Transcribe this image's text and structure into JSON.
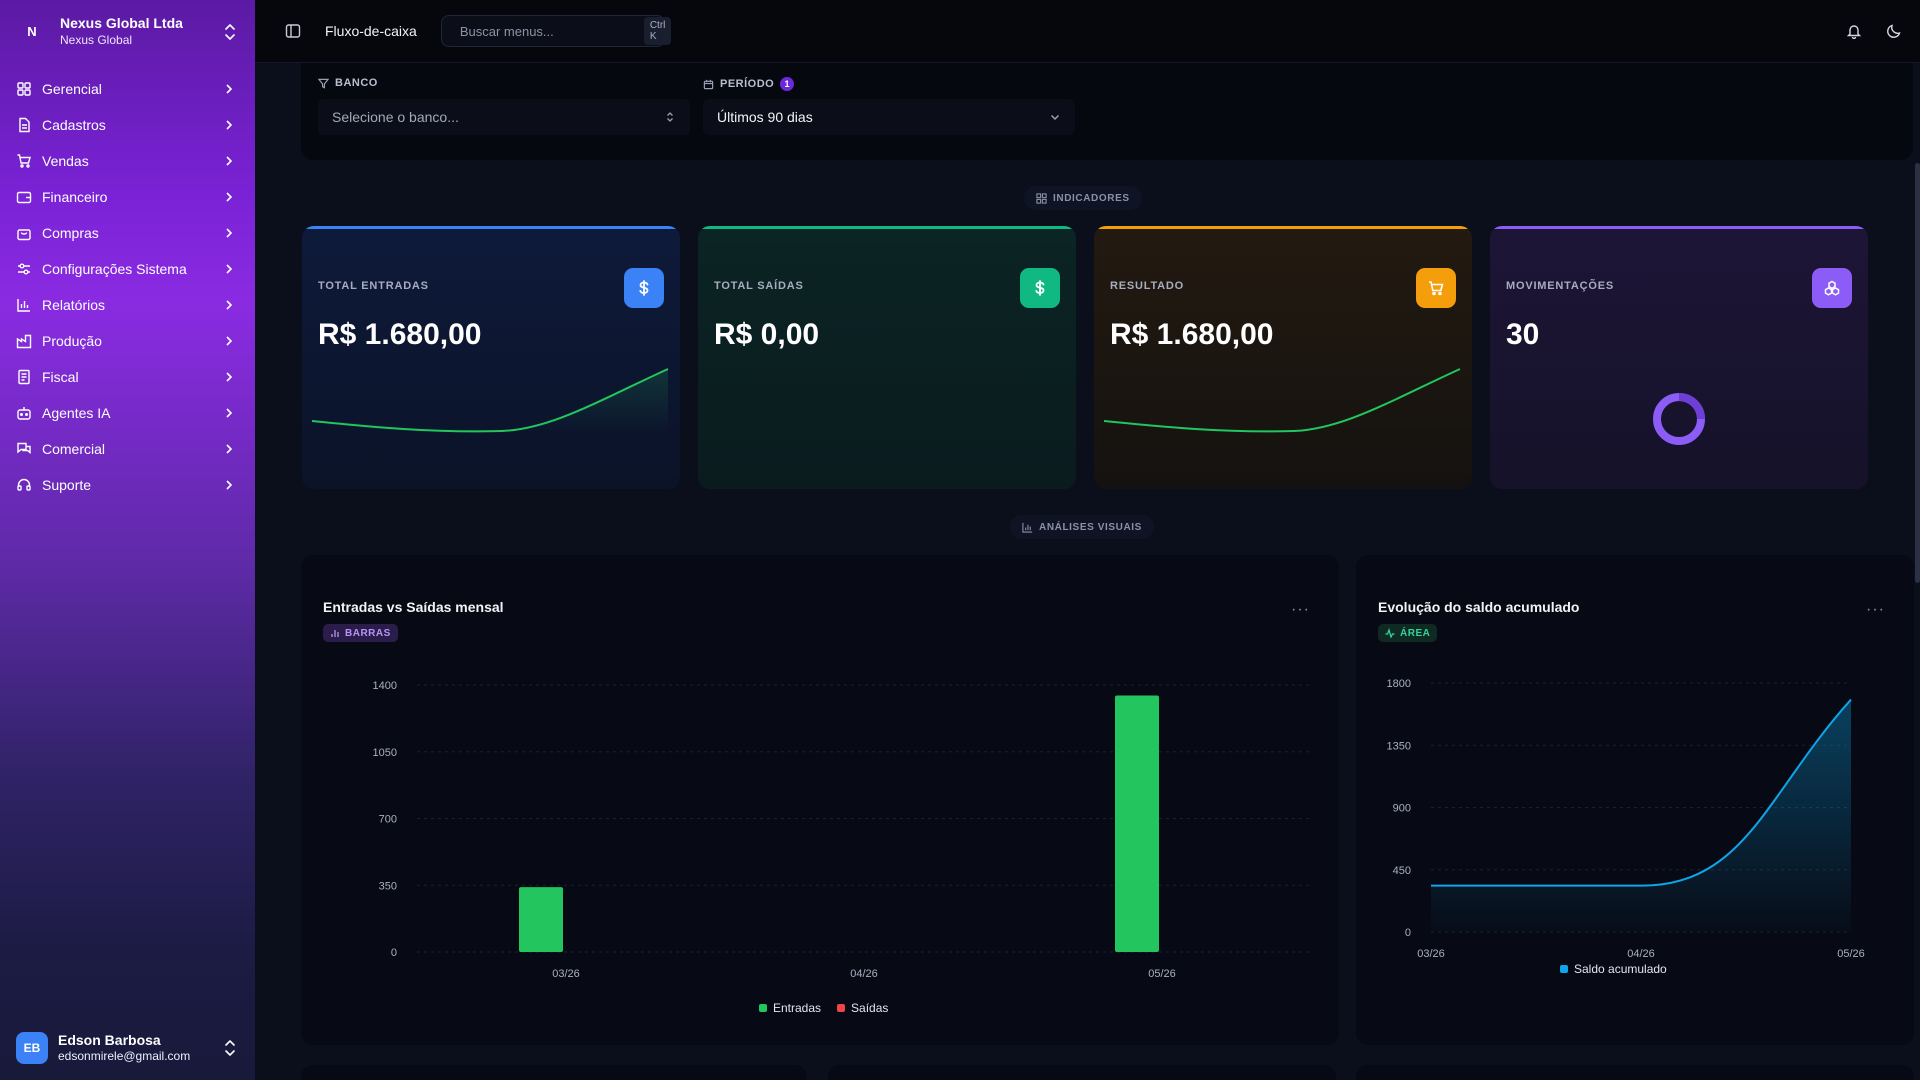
{
  "org": {
    "initial": "N",
    "name": "Nexus Global Ltda",
    "sub": "Nexus Global"
  },
  "sidebar": {
    "items": [
      {
        "label": "Gerencial",
        "icon": "grid-icon"
      },
      {
        "label": "Cadastros",
        "icon": "file-text-icon"
      },
      {
        "label": "Vendas",
        "icon": "cart-icon"
      },
      {
        "label": "Financeiro",
        "icon": "wallet-icon"
      },
      {
        "label": "Compras",
        "icon": "shopping-bag-icon"
      },
      {
        "label": "Configurações Sistema",
        "icon": "sliders-icon"
      },
      {
        "label": "Relatórios",
        "icon": "bar-chart-icon"
      },
      {
        "label": "Produção",
        "icon": "factory-icon"
      },
      {
        "label": "Fiscal",
        "icon": "receipt-icon"
      },
      {
        "label": "Agentes IA",
        "icon": "bot-icon"
      },
      {
        "label": "Comercial",
        "icon": "messages-icon"
      },
      {
        "label": "Suporte",
        "icon": "headset-icon"
      }
    ]
  },
  "user": {
    "initials": "EB",
    "name": "Edson Barbosa",
    "email": "edsonmirele@gmail.com"
  },
  "topbar": {
    "page": "Fluxo-de-caixa",
    "search_placeholder": "Buscar menus...",
    "search_shortcut": "Ctrl K"
  },
  "filters": {
    "banco_label": "BANCO",
    "banco_placeholder": "Selecione o banco...",
    "periodo_label": "PERÍODO",
    "periodo_badge": "1",
    "periodo_value": "Últimos 90 dias"
  },
  "sections": {
    "indicadores": "INDICADORES",
    "analises": "ANÁLISES VISUAIS"
  },
  "kpis": [
    {
      "label": "TOTAL ENTRADAS",
      "value": "R$ 1.680,00",
      "color": "#3b82f6",
      "icon": "dollar-icon"
    },
    {
      "label": "TOTAL SAÍDAS",
      "value": "R$ 0,00",
      "color": "#10b981",
      "icon": "dollar-icon"
    },
    {
      "label": "RESULTADO",
      "value": "R$ 1.680,00",
      "color": "#f59e0b",
      "icon": "cart-icon"
    },
    {
      "label": "MOVIMENTAÇÕES",
      "value": "30",
      "color": "#8b5cf6",
      "icon": "boxes-icon"
    }
  ],
  "colors": {
    "entradas": "#22c55e",
    "saidas": "#ef4444",
    "saldo": "#0ea5e9"
  },
  "chart_data": [
    {
      "type": "bar",
      "title": "Entradas vs Saídas mensal",
      "tag": "BARRAS",
      "categories": [
        "03/26",
        "04/26",
        "05/26"
      ],
      "series": [
        {
          "name": "Entradas",
          "values": [
            340,
            0,
            1345
          ]
        },
        {
          "name": "Saídas",
          "values": [
            0,
            0,
            0
          ]
        }
      ],
      "yticks": [
        "0",
        "350",
        "700",
        "1050",
        "1400"
      ],
      "ylim": [
        0,
        1400
      ],
      "grid": true,
      "legend": "bottom"
    },
    {
      "type": "area",
      "title": "Evolução do saldo acumulado",
      "tag": "ÁREA",
      "categories": [
        "03/26",
        "04/26",
        "05/26"
      ],
      "series": [
        {
          "name": "Saldo acumulado",
          "values": [
            335,
            335,
            1680
          ]
        }
      ],
      "yticks": [
        "0",
        "450",
        "900",
        "1350",
        "1800"
      ],
      "ylim": [
        0,
        1800
      ],
      "grid": true,
      "legend": "bottom"
    }
  ]
}
